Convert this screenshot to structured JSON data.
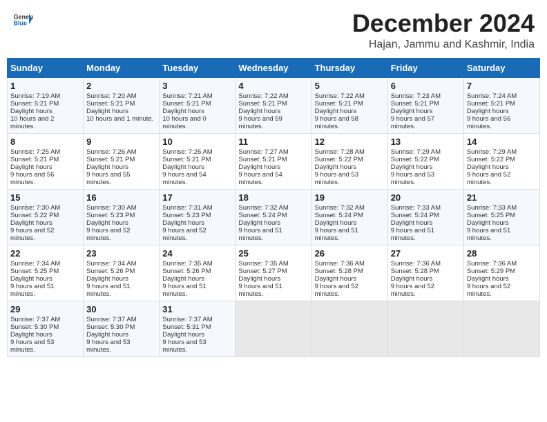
{
  "logo": {
    "general": "General",
    "blue": "Blue"
  },
  "header": {
    "month_title": "December 2024",
    "location": "Hajan, Jammu and Kashmir, India"
  },
  "weekdays": [
    "Sunday",
    "Monday",
    "Tuesday",
    "Wednesday",
    "Thursday",
    "Friday",
    "Saturday"
  ],
  "weeks": [
    [
      {
        "day": "1",
        "sunrise": "7:19 AM",
        "sunset": "5:21 PM",
        "daylight": "10 hours and 2 minutes."
      },
      {
        "day": "2",
        "sunrise": "7:20 AM",
        "sunset": "5:21 PM",
        "daylight": "10 hours and 1 minute."
      },
      {
        "day": "3",
        "sunrise": "7:21 AM",
        "sunset": "5:21 PM",
        "daylight": "10 hours and 0 minutes."
      },
      {
        "day": "4",
        "sunrise": "7:22 AM",
        "sunset": "5:21 PM",
        "daylight": "9 hours and 59 minutes."
      },
      {
        "day": "5",
        "sunrise": "7:22 AM",
        "sunset": "5:21 PM",
        "daylight": "9 hours and 58 minutes."
      },
      {
        "day": "6",
        "sunrise": "7:23 AM",
        "sunset": "5:21 PM",
        "daylight": "9 hours and 57 minutes."
      },
      {
        "day": "7",
        "sunrise": "7:24 AM",
        "sunset": "5:21 PM",
        "daylight": "9 hours and 56 minutes."
      }
    ],
    [
      {
        "day": "8",
        "sunrise": "7:25 AM",
        "sunset": "5:21 PM",
        "daylight": "9 hours and 56 minutes."
      },
      {
        "day": "9",
        "sunrise": "7:26 AM",
        "sunset": "5:21 PM",
        "daylight": "9 hours and 55 minutes."
      },
      {
        "day": "10",
        "sunrise": "7:26 AM",
        "sunset": "5:21 PM",
        "daylight": "9 hours and 54 minutes."
      },
      {
        "day": "11",
        "sunrise": "7:27 AM",
        "sunset": "5:21 PM",
        "daylight": "9 hours and 54 minutes."
      },
      {
        "day": "12",
        "sunrise": "7:28 AM",
        "sunset": "5:22 PM",
        "daylight": "9 hours and 53 minutes."
      },
      {
        "day": "13",
        "sunrise": "7:29 AM",
        "sunset": "5:22 PM",
        "daylight": "9 hours and 53 minutes."
      },
      {
        "day": "14",
        "sunrise": "7:29 AM",
        "sunset": "5:22 PM",
        "daylight": "9 hours and 52 minutes."
      }
    ],
    [
      {
        "day": "15",
        "sunrise": "7:30 AM",
        "sunset": "5:22 PM",
        "daylight": "9 hours and 52 minutes."
      },
      {
        "day": "16",
        "sunrise": "7:30 AM",
        "sunset": "5:23 PM",
        "daylight": "9 hours and 52 minutes."
      },
      {
        "day": "17",
        "sunrise": "7:31 AM",
        "sunset": "5:23 PM",
        "daylight": "9 hours and 52 minutes."
      },
      {
        "day": "18",
        "sunrise": "7:32 AM",
        "sunset": "5:24 PM",
        "daylight": "9 hours and 51 minutes."
      },
      {
        "day": "19",
        "sunrise": "7:32 AM",
        "sunset": "5:24 PM",
        "daylight": "9 hours and 51 minutes."
      },
      {
        "day": "20",
        "sunrise": "7:33 AM",
        "sunset": "5:24 PM",
        "daylight": "9 hours and 51 minutes."
      },
      {
        "day": "21",
        "sunrise": "7:33 AM",
        "sunset": "5:25 PM",
        "daylight": "9 hours and 51 minutes."
      }
    ],
    [
      {
        "day": "22",
        "sunrise": "7:34 AM",
        "sunset": "5:25 PM",
        "daylight": "9 hours and 51 minutes."
      },
      {
        "day": "23",
        "sunrise": "7:34 AM",
        "sunset": "5:26 PM",
        "daylight": "9 hours and 51 minutes."
      },
      {
        "day": "24",
        "sunrise": "7:35 AM",
        "sunset": "5:26 PM",
        "daylight": "9 hours and 51 minutes."
      },
      {
        "day": "25",
        "sunrise": "7:35 AM",
        "sunset": "5:27 PM",
        "daylight": "9 hours and 51 minutes."
      },
      {
        "day": "26",
        "sunrise": "7:36 AM",
        "sunset": "5:28 PM",
        "daylight": "9 hours and 52 minutes."
      },
      {
        "day": "27",
        "sunrise": "7:36 AM",
        "sunset": "5:28 PM",
        "daylight": "9 hours and 52 minutes."
      },
      {
        "day": "28",
        "sunrise": "7:36 AM",
        "sunset": "5:29 PM",
        "daylight": "9 hours and 52 minutes."
      }
    ],
    [
      {
        "day": "29",
        "sunrise": "7:37 AM",
        "sunset": "5:30 PM",
        "daylight": "9 hours and 53 minutes."
      },
      {
        "day": "30",
        "sunrise": "7:37 AM",
        "sunset": "5:30 PM",
        "daylight": "9 hours and 53 minutes."
      },
      {
        "day": "31",
        "sunrise": "7:37 AM",
        "sunset": "5:31 PM",
        "daylight": "9 hours and 53 minutes."
      },
      null,
      null,
      null,
      null
    ]
  ],
  "labels": {
    "sunrise": "Sunrise:",
    "sunset": "Sunset:",
    "daylight": "Daylight hours"
  }
}
